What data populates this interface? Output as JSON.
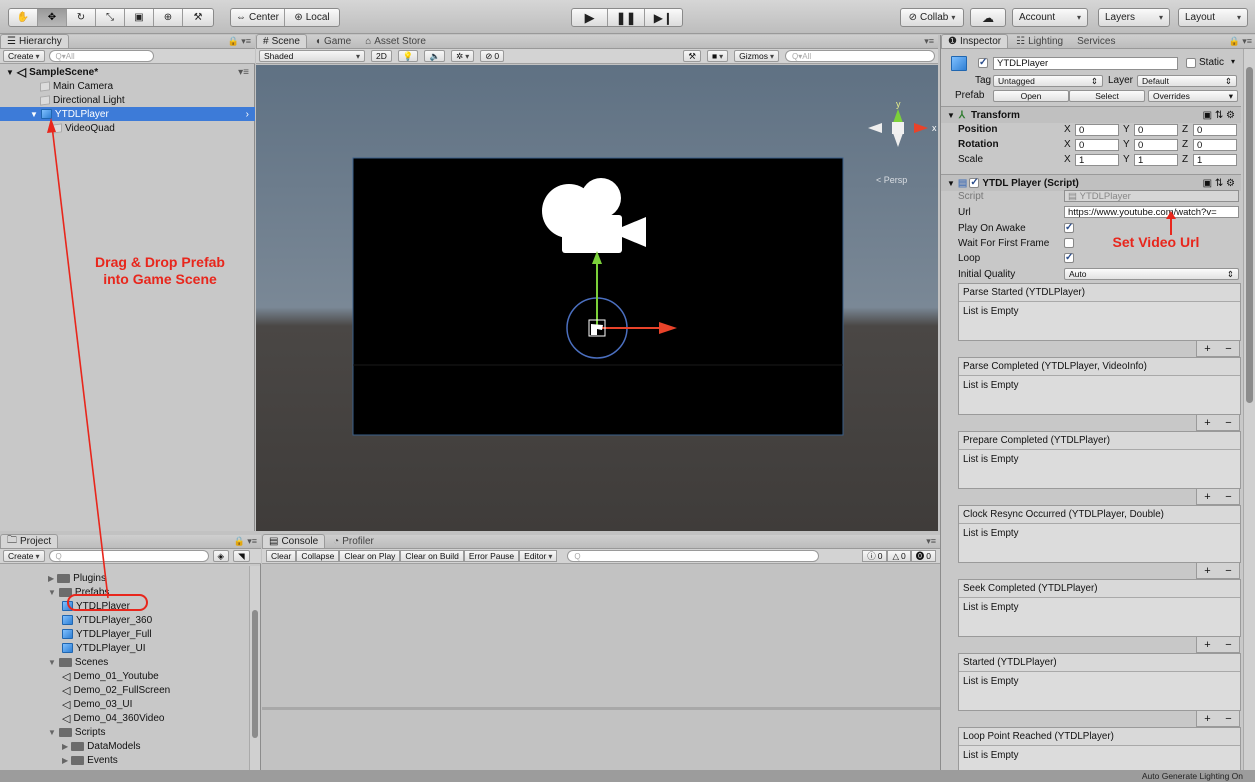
{
  "toolbar": {
    "pivot_label": "Center",
    "space_label": "Local",
    "collab_label": "Collab",
    "account_label": "Account",
    "layers_label": "Layers",
    "layout_label": "Layout"
  },
  "hierarchy": {
    "tab_label": "Hierarchy",
    "create_label": "Create",
    "search_placeholder": "Q▾All",
    "scene_name": "SampleScene*",
    "items": [
      "Main Camera",
      "Directional Light",
      "YTDLPlayer",
      "VideoQuad"
    ]
  },
  "scene": {
    "tabs": [
      "Scene",
      "Game",
      "Asset Store"
    ],
    "shading": "Shaded",
    "mode_2d": "2D",
    "fx_count": "0",
    "gizmos_label": "Gizmos",
    "search_placeholder": "Q▾All",
    "persp_label": "< Persp",
    "axis_y": "y",
    "axis_x": "x"
  },
  "inspector": {
    "tabs": [
      "Inspector",
      "Lighting",
      "Services"
    ],
    "object_name": "YTDLPlayer",
    "static_label": "Static",
    "tag_label": "Tag",
    "tag_value": "Untagged",
    "layer_label": "Layer",
    "layer_value": "Default",
    "prefab_label": "Prefab",
    "prefab_open": "Open",
    "prefab_select": "Select",
    "prefab_overrides": "Overrides",
    "transform": {
      "title": "Transform",
      "rows": [
        {
          "label": "Position",
          "x": "0",
          "y": "0",
          "z": "0"
        },
        {
          "label": "Rotation",
          "x": "0",
          "y": "0",
          "z": "0"
        },
        {
          "label": "Scale",
          "x": "1",
          "y": "1",
          "z": "1"
        }
      ]
    },
    "script": {
      "title": "YTDL Player (Script)",
      "script_label": "Script",
      "script_value": "YTDLPlayer",
      "url_label": "Url",
      "url_value": "https://www.youtube.com/watch?v=",
      "play_on_awake_label": "Play On Awake",
      "wait_label": "Wait For First Frame",
      "loop_label": "Loop",
      "quality_label": "Initial Quality",
      "quality_value": "Auto"
    },
    "events": [
      {
        "title": "Parse Started (YTDLPlayer)",
        "body": "List is Empty"
      },
      {
        "title": "Parse Completed (YTDLPlayer, VideoInfo)",
        "body": "List is Empty"
      },
      {
        "title": "Prepare Completed (YTDLPlayer)",
        "body": "List is Empty"
      },
      {
        "title": "Clock Resync Occurred (YTDLPlayer, Double)",
        "body": "List is Empty"
      },
      {
        "title": "Seek Completed (YTDLPlayer)",
        "body": "List is Empty"
      },
      {
        "title": "Started (YTDLPlayer)",
        "body": "List is Empty"
      },
      {
        "title": "Loop Point Reached (YTDLPlayer)",
        "body": "List is Empty"
      }
    ],
    "plus": "+",
    "minus": "−"
  },
  "project": {
    "tab_label": "Project",
    "create_label": "Create",
    "items": [
      {
        "name": "Plugins",
        "type": "folder",
        "indent": 1
      },
      {
        "name": "Prefabs",
        "type": "folder-open",
        "indent": 1
      },
      {
        "name": "YTDLPlayer",
        "type": "prefab",
        "indent": 2
      },
      {
        "name": "YTDLPlayer_360",
        "type": "prefab",
        "indent": 2
      },
      {
        "name": "YTDLPlayer_Full",
        "type": "prefab",
        "indent": 2
      },
      {
        "name": "YTDLPlayer_UI",
        "type": "prefab",
        "indent": 2
      },
      {
        "name": "Scenes",
        "type": "folder-open",
        "indent": 1
      },
      {
        "name": "Demo_01_Youtube",
        "type": "scene",
        "indent": 2
      },
      {
        "name": "Demo_02_FullScreen",
        "type": "scene",
        "indent": 2
      },
      {
        "name": "Demo_03_UI",
        "type": "scene",
        "indent": 2
      },
      {
        "name": "Demo_04_360Video",
        "type": "scene",
        "indent": 2
      },
      {
        "name": "Scripts",
        "type": "folder-open",
        "indent": 1
      },
      {
        "name": "DataModels",
        "type": "folder",
        "indent": 2
      },
      {
        "name": "Events",
        "type": "folder",
        "indent": 2
      }
    ]
  },
  "console": {
    "tabs": [
      "Console",
      "Profiler"
    ],
    "buttons": [
      "Clear",
      "Collapse",
      "Clear on Play",
      "Clear on Build",
      "Error Pause",
      "Editor"
    ],
    "log_count": "0",
    "warn_count": "0",
    "error_count": "0"
  },
  "annotations": {
    "drag_drop": "Drag & Drop Prefab\ninto Game Scene",
    "set_url": "Set Video Url"
  },
  "statusbar": {
    "text": "Auto Generate Lighting On"
  },
  "colors": {
    "selection": "#3d7bd8",
    "annotation": "#e8261c",
    "scene_black": "#000000"
  }
}
